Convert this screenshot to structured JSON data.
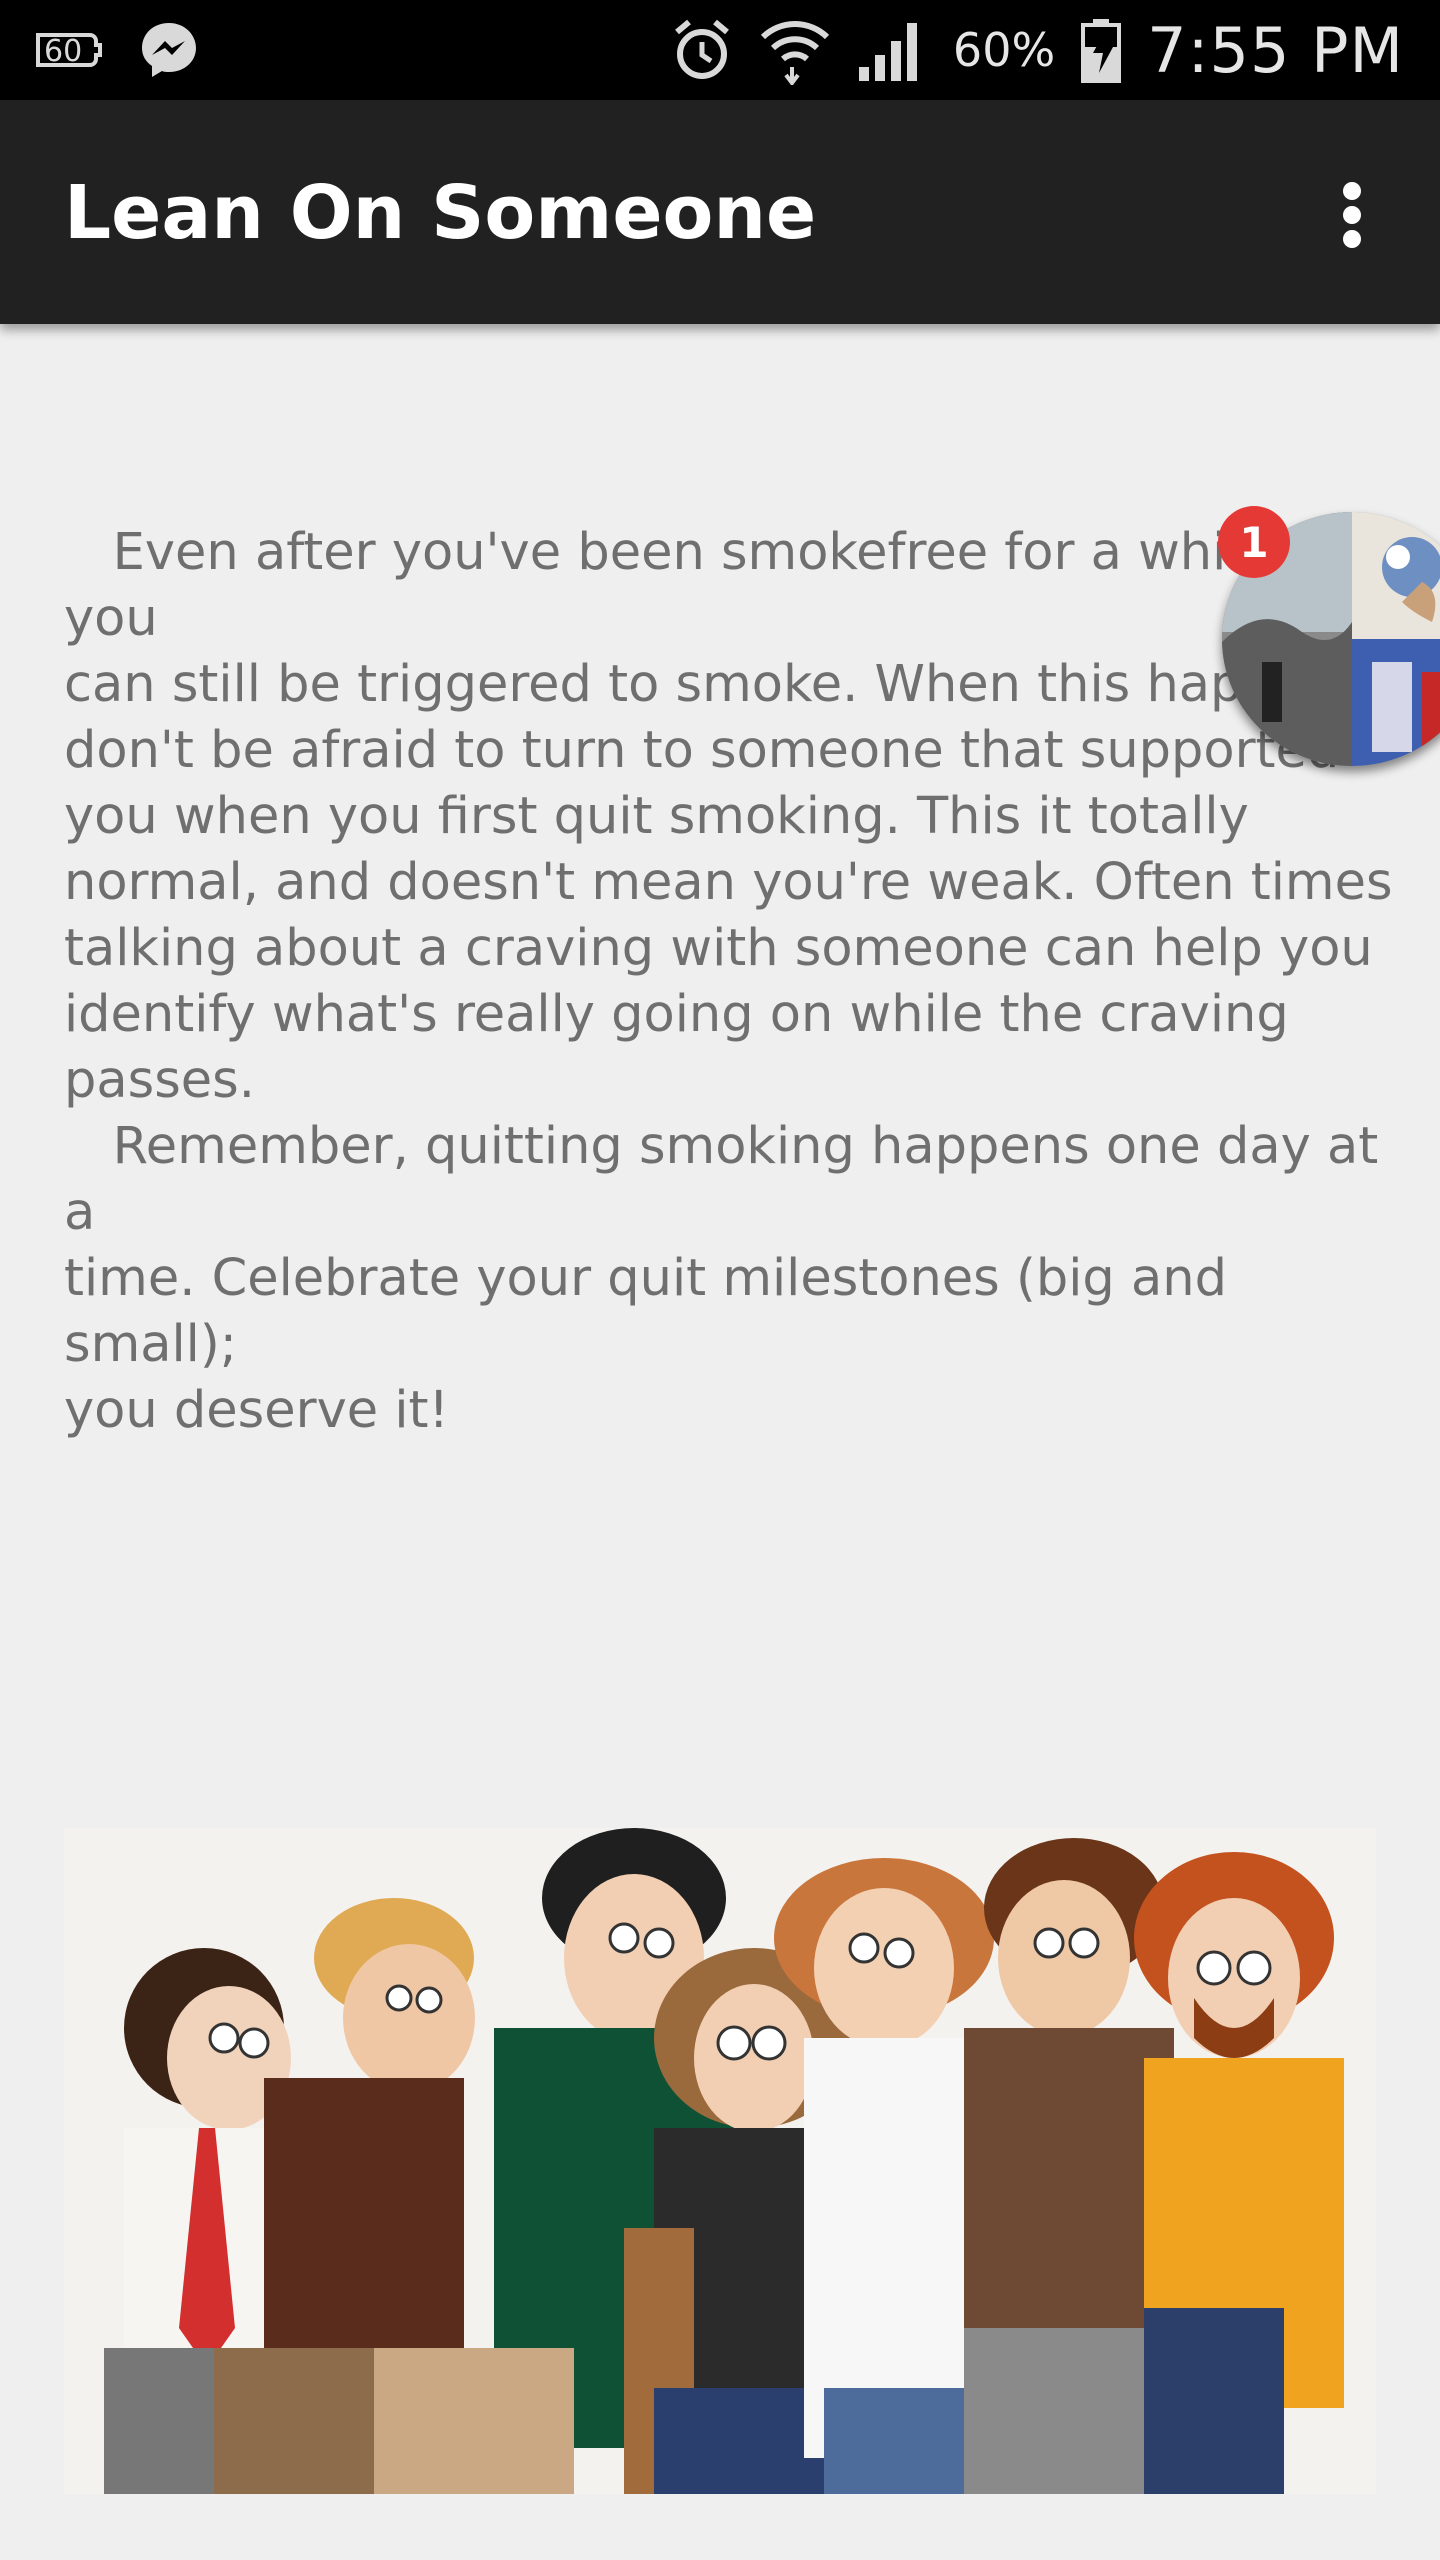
{
  "status_bar": {
    "notification_icons": [
      "60-second-icon",
      "messenger-icon"
    ],
    "system_icons": [
      "alarm-icon",
      "wifi-icon",
      "signal-icon",
      "battery-charging-icon"
    ],
    "battery_percent": "60%",
    "time": "7:55 PM"
  },
  "app_bar": {
    "title": "Lean On Someone",
    "overflow_icon": "more-vert-icon"
  },
  "content": {
    "body_text": "   Even after you've been smokefree for a while, you\ncan still be triggered to smoke. When this happens,\ndon't be afraid to turn to someone that supported\nyou when you first quit smoking. This it totally\nnormal, and doesn't mean you're weak. Often times\ntalking about a craving with someone can help you\nidentify what's really going on while the craving\npasses.\n   Remember, quitting smoking happens one day at a\ntime. Celebrate your quit milestones (big and small);\nyou deserve it!"
  },
  "image": {
    "description_icon": "group-of-friends-illustration"
  },
  "chat_head": {
    "badge_count": "1"
  },
  "colors": {
    "status_bar": "#000000",
    "app_bar": "#212121",
    "background": "#efefef",
    "body_text": "#6f6f6f",
    "badge": "#e53935"
  }
}
